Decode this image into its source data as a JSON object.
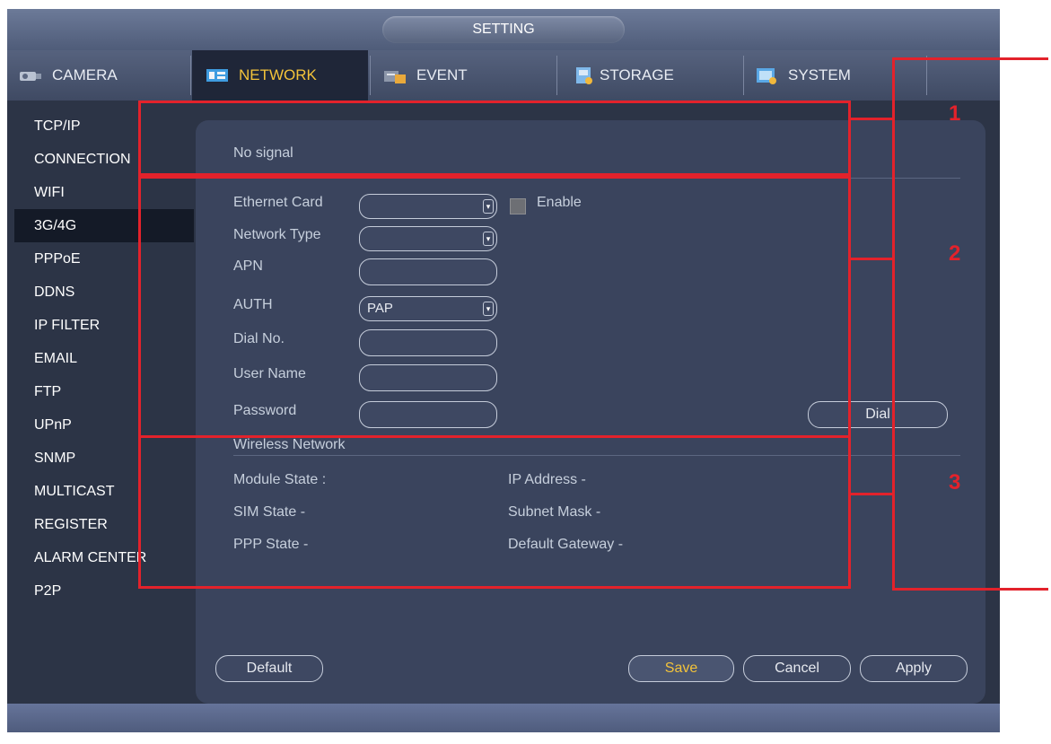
{
  "window": {
    "title": "SETTING"
  },
  "tabs": [
    {
      "label": "CAMERA",
      "icon": "camera-icon"
    },
    {
      "label": "NETWORK",
      "icon": "network-icon",
      "active": true
    },
    {
      "label": "EVENT",
      "icon": "event-icon"
    },
    {
      "label": "STORAGE",
      "icon": "storage-icon"
    },
    {
      "label": "SYSTEM",
      "icon": "system-icon"
    }
  ],
  "sidebar": {
    "items": [
      "TCP/IP",
      "CONNECTION",
      "WIFI",
      "3G/4G",
      "PPPoE",
      "DDNS",
      "IP FILTER",
      "EMAIL",
      "FTP",
      "UPnP",
      "SNMP",
      "MULTICAST",
      "REGISTER",
      "ALARM CENTER",
      "P2P"
    ],
    "active": "3G/4G"
  },
  "signal": {
    "text": "No signal"
  },
  "form": {
    "ethernet_card": {
      "label": "Ethernet Card",
      "value": ""
    },
    "enable": {
      "label": "Enable",
      "checked": false
    },
    "network_type": {
      "label": "Network Type",
      "value": ""
    },
    "apn": {
      "label": "APN",
      "value": ""
    },
    "auth": {
      "label": "AUTH",
      "value": "PAP"
    },
    "dial_no": {
      "label": "Dial No.",
      "value": ""
    },
    "user_name": {
      "label": "User Name",
      "value": ""
    },
    "password": {
      "label": "Password",
      "value": ""
    },
    "dial_button": "Dial"
  },
  "wireless": {
    "title": "Wireless Network",
    "module_state": "Module State :",
    "sim_state": "SIM State -",
    "ppp_state": "PPP State -",
    "ip_address": "IP Address -",
    "subnet_mask": "Subnet Mask -",
    "default_gateway": "Default Gateway -"
  },
  "buttons": {
    "default": "Default",
    "save": "Save",
    "cancel": "Cancel",
    "apply": "Apply"
  },
  "callouts": [
    "1",
    "2",
    "3"
  ],
  "colors": {
    "accent": "#f3c33a",
    "highlight": "#e3222b",
    "panel": "#3a445d",
    "background": "#2c3446"
  }
}
